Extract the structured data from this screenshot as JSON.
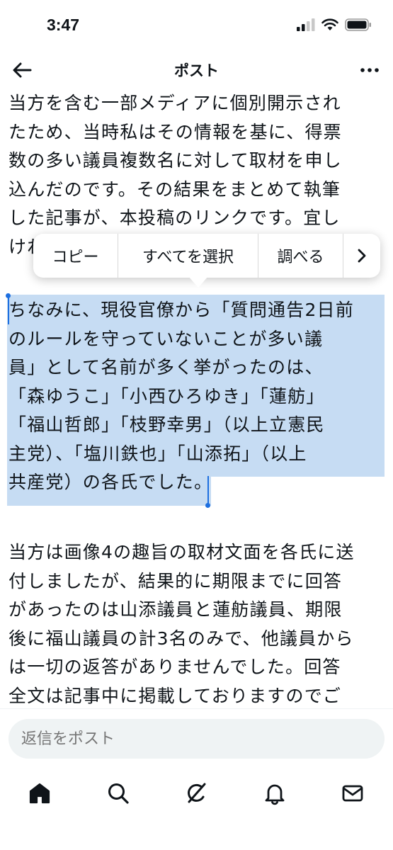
{
  "status_bar": {
    "time": "3:47",
    "icons": [
      "cellular-signal-icon",
      "wifi-icon",
      "battery-icon"
    ]
  },
  "nav": {
    "title": "ポスト",
    "back_icon": "back-arrow-icon",
    "more_icon": "more-options-icon"
  },
  "post": {
    "paragraph_1": "当方を含む一部メディアに個別開示され\nたため、当時私はその情報を基に、得票\n数の多い議員複数名に対して取材を申し\n込んだのです。その結果をまとめて執筆\nした記事が、本投稿のリンクです。宜し\nければ",
    "paragraph_2": "ちなみに、現役官僚から「質問通告2日前\nのルールを守っていないことが多い議\n員」として名前が多く挙がったのは、\n「森ゆうこ」「小西ひろゆき」「蓮舫」\n「福山哲郎」「枝野幸男」（以上立憲民\n主党）、「塩川鉄也」「山添拓」（以上\n共産党）の各氏でした。",
    "paragraph_3": "当方は画像4の趣旨の取材文面を各氏に送\n付しましたが、結果的に期限までに回答\nがあったのは山添議員と蓮舫議員、期限\n後に福山議員の計3名のみで、他議員から\nは一切の返答がありませんでした。回答\n全文は記事中に掲載しておりますのでご"
  },
  "context_menu": {
    "copy": "コピー",
    "select_all": "すべてを選択",
    "look_up": "調べる",
    "more_icon": "chevron-right-icon"
  },
  "reply": {
    "placeholder": "返信をポスト"
  },
  "tab_bar": {
    "items": [
      "home-icon",
      "search-icon",
      "grok-icon",
      "notifications-icon",
      "messages-icon"
    ]
  },
  "colors": {
    "selection": "#c6dcf3",
    "caret": "#1d6fe0",
    "text": "#0f1419",
    "reply_bg": "#eff3f4"
  }
}
